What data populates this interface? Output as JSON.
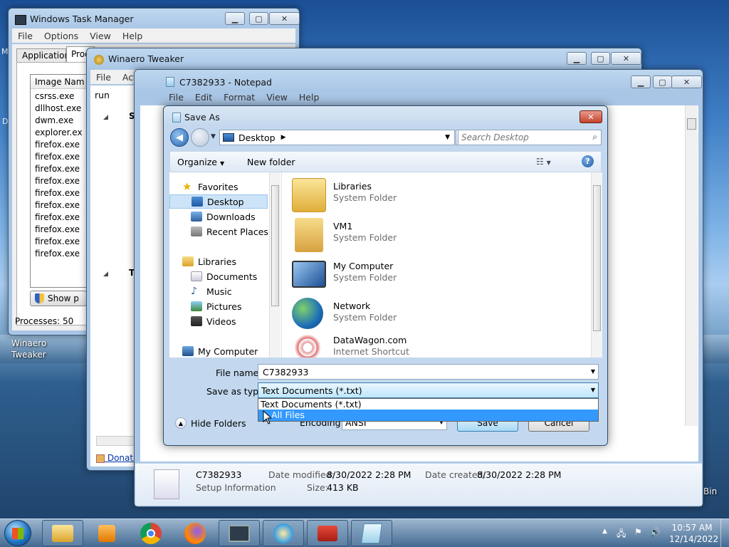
{
  "desktop": {
    "icon_label_line1": "Winaero",
    "icon_label_line2": "Tweaker",
    "recycle_fragment": "Bin",
    "left_fragment_m": "M",
    "left_fragment_d": "D"
  },
  "task_manager": {
    "title": "Windows Task Manager",
    "menu": [
      "File",
      "Options",
      "View",
      "Help"
    ],
    "tabs": [
      "Applications",
      "Proc"
    ],
    "column_header": "Image Nam",
    "processes": [
      "csrss.exe",
      "dllhost.exe",
      "dwm.exe",
      "explorer.ex",
      "firefox.exe",
      "firefox.exe",
      "firefox.exe",
      "firefox.exe",
      "firefox.exe",
      "firefox.exe",
      "firefox.exe",
      "firefox.exe",
      "firefox.exe",
      "firefox.exe"
    ],
    "show_button": "Show p",
    "status": "Processes: 50"
  },
  "tweaker": {
    "title": "Winaero Tweaker",
    "menu": [
      "File",
      "Actions"
    ],
    "search_text": "run",
    "tree_s": "S",
    "tree_t": "T",
    "donate_link": "Donate"
  },
  "notepad": {
    "title": "C7382933 - Notepad",
    "menu": [
      "File",
      "Edit",
      "Format",
      "View",
      "Help"
    ]
  },
  "explorer_details": {
    "name": "C7382933",
    "type": "Setup Information",
    "date_modified_label": "Date modified:",
    "date_modified": "8/30/2022 2:28 PM",
    "date_created_label": "Date created:",
    "date_created": "8/30/2022 2:28 PM",
    "size_label": "Size:",
    "size": "413 KB"
  },
  "save_as": {
    "title": "Save As",
    "address": "Desktop",
    "search_placeholder": "Search Desktop",
    "organize": "Organize",
    "new_folder": "New folder",
    "nav": {
      "favorites": "Favorites",
      "desktop": "Desktop",
      "downloads": "Downloads",
      "recent": "Recent Places",
      "libraries": "Libraries",
      "documents": "Documents",
      "music": "Music",
      "pictures": "Pictures",
      "videos": "Videos",
      "computer": "My Computer"
    },
    "items": [
      {
        "name": "Libraries",
        "type": "System Folder",
        "icon": "libraries-icon"
      },
      {
        "name": "VM1",
        "type": "System Folder",
        "icon": "user-folder-icon"
      },
      {
        "name": "My Computer",
        "type": "System Folder",
        "icon": "computer-icon"
      },
      {
        "name": "Network",
        "type": "System Folder",
        "icon": "network-icon"
      },
      {
        "name": "DataWagon.com",
        "type": "Internet Shortcut",
        "icon": "shortcut-icon"
      }
    ],
    "file_name_label": "File name:",
    "file_name_value": "C7382933",
    "save_type_label": "Save as type:",
    "save_type_value": "Text Documents (*.txt)",
    "dropdown_options": [
      "Text Documents (*.txt)",
      "All Files"
    ],
    "encoding_label": "Encoding:",
    "encoding_value": "ANSI",
    "save_button": "Save",
    "cancel_button": "Cancel",
    "hide_folders": "Hide Folders"
  },
  "taskbar": {
    "time": "10:57 AM",
    "date": "12/14/2022"
  }
}
